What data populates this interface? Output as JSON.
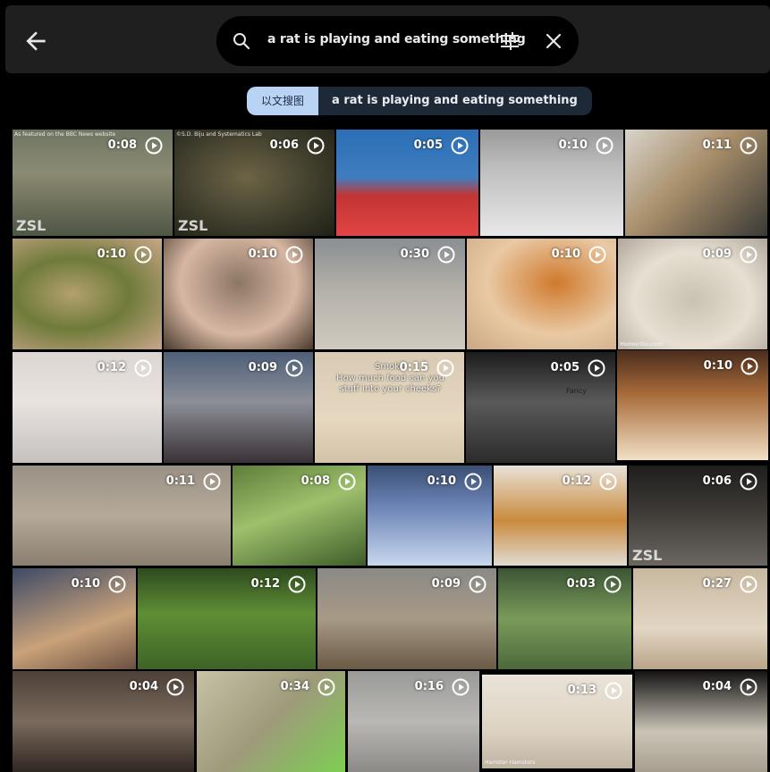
{
  "search": {
    "query": "a rat is playing and eating something",
    "mode_label": "以文搜图",
    "chip_query": "a rat is playing and eating something"
  },
  "icons": {
    "back": "arrow-left-icon",
    "search": "search-icon",
    "filter": "tune-icon",
    "clear": "close-icon",
    "play": "play-circle-icon"
  },
  "colors": {
    "selected_outline": "#e02020",
    "chip_mode_bg": "#b9d3f5",
    "chip_query_bg": "#1e2938"
  },
  "results": [
    {
      "duration": "0:08",
      "caption": "As featured on the BBC News website",
      "watermark": "ZSL"
    },
    {
      "duration": "0:06",
      "caption": "©S.D. Biju and Systematics Lab",
      "watermark": "ZSL"
    },
    {
      "duration": "0:05"
    },
    {
      "duration": "0:10"
    },
    {
      "duration": "0:11"
    },
    {
      "duration": "0:10"
    },
    {
      "duration": "0:10"
    },
    {
      "duration": "0:30"
    },
    {
      "duration": "0:10"
    },
    {
      "duration": "0:09",
      "watermark": "HumorOn.com"
    },
    {
      "duration": "0:12"
    },
    {
      "duration": "0:09"
    },
    {
      "duration": "0:15",
      "overlay_title": "Smoke",
      "overlay_line": "How much food can you stuff into your cheeks?"
    },
    {
      "duration": "0:05",
      "overlay_title": "Fancy"
    },
    {
      "duration": "0:10",
      "selected": true
    },
    {
      "duration": "0:11"
    },
    {
      "duration": "0:08"
    },
    {
      "duration": "0:10"
    },
    {
      "duration": "0:12"
    },
    {
      "duration": "0:06",
      "watermark": "ZSL"
    },
    {
      "duration": "0:10"
    },
    {
      "duration": "0:12"
    },
    {
      "duration": "0:09"
    },
    {
      "duration": "0:03"
    },
    {
      "duration": "0:27"
    },
    {
      "duration": "0:04"
    },
    {
      "duration": "0:34"
    },
    {
      "duration": "0:16"
    },
    {
      "duration": "0:13",
      "caption": "Hamster Hamsters"
    },
    {
      "duration": "0:04"
    }
  ]
}
